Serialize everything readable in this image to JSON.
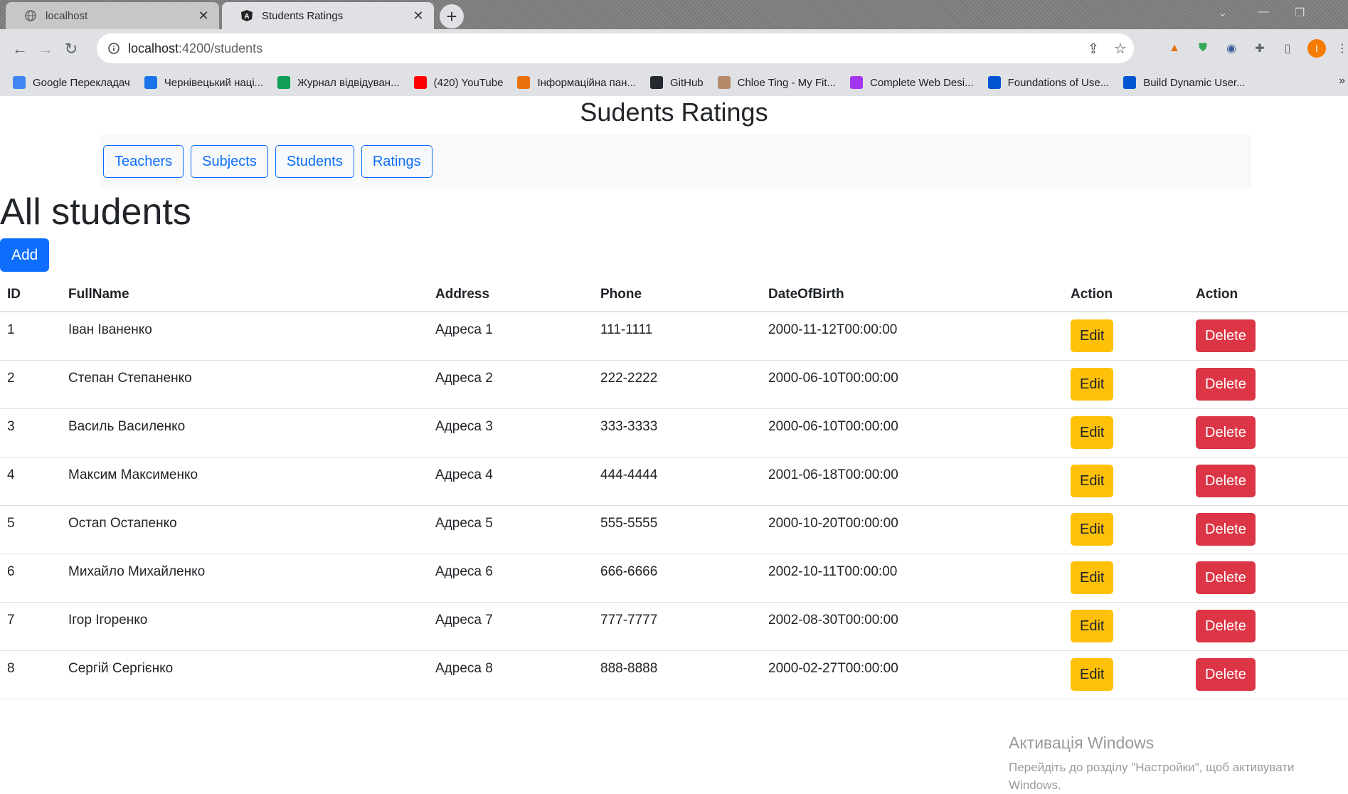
{
  "browser": {
    "tabs": [
      {
        "title": "localhost",
        "active": false
      },
      {
        "title": "Students Ratings",
        "active": true
      }
    ],
    "url_host": "localhost",
    "url_path": ":4200/students",
    "bookmarks": [
      {
        "label": "Google Перекладач",
        "icon": "google-translate-icon",
        "color": "#4285f4"
      },
      {
        "label": "Чернівецький наці...",
        "icon": "calendar-icon",
        "color": "#1a73e8"
      },
      {
        "label": "Журнал відвідуван...",
        "icon": "sheets-icon",
        "color": "#0f9d58"
      },
      {
        "label": "(420) YouTube",
        "icon": "youtube-icon",
        "color": "#ff0000"
      },
      {
        "label": "Інформаційна пан...",
        "icon": "graduation-cap-icon",
        "color": "#e8710a"
      },
      {
        "label": "GitHub",
        "icon": "github-icon",
        "color": "#24292f"
      },
      {
        "label": "Chloe Ting - My Fit...",
        "icon": "avatar-icon",
        "color": "#b58a6a"
      },
      {
        "label": "Complete Web Desi...",
        "icon": "udemy-icon",
        "color": "#a435f0"
      },
      {
        "label": "Foundations of Use...",
        "icon": "coursera-icon",
        "color": "#0056d2"
      },
      {
        "label": "Build Dynamic User...",
        "icon": "coursera-icon",
        "color": "#0056d2"
      }
    ],
    "more_bookmarks": "»"
  },
  "app": {
    "title": "Sudents Ratings",
    "nav": [
      "Teachers",
      "Subjects",
      "Students",
      "Ratings"
    ],
    "heading": "All students",
    "add_label": "Add"
  },
  "table": {
    "headers": [
      "ID",
      "FullName",
      "Address",
      "Phone",
      "DateOfBirth",
      "Action",
      "Action"
    ],
    "edit_label": "Edit",
    "delete_label": "Delete",
    "rows": [
      {
        "id": "1",
        "name": "Іван Іваненко",
        "address": "Адреса 1",
        "phone": "111-1111",
        "dob": "2000-11-12T00:00:00"
      },
      {
        "id": "2",
        "name": "Степан Степаненко",
        "address": "Адреса 2",
        "phone": "222-2222",
        "dob": "2000-06-10T00:00:00"
      },
      {
        "id": "3",
        "name": "Василь Василенко",
        "address": "Адреса 3",
        "phone": "333-3333",
        "dob": "2000-06-10T00:00:00"
      },
      {
        "id": "4",
        "name": "Максим Максименко",
        "address": "Адреса 4",
        "phone": "444-4444",
        "dob": "2001-06-18T00:00:00"
      },
      {
        "id": "5",
        "name": "Остап Остапенко",
        "address": "Адреса 5",
        "phone": "555-5555",
        "dob": "2000-10-20T00:00:00"
      },
      {
        "id": "6",
        "name": "Михайло Михайленко",
        "address": "Адреса 6",
        "phone": "666-6666",
        "dob": "2002-10-11T00:00:00"
      },
      {
        "id": "7",
        "name": "Ігор Ігоренко",
        "address": "Адреса 7",
        "phone": "777-7777",
        "dob": "2002-08-30T00:00:00"
      },
      {
        "id": "8",
        "name": "Сергій Сергієнко",
        "address": "Адреса 8",
        "phone": "888-8888",
        "dob": "2000-02-27T00:00:00"
      }
    ]
  },
  "watermark": {
    "line1": "Активація Windows",
    "line2": "Перейдіть до розділу \"Настройки\", щоб активувати Windows."
  },
  "colors": {
    "primary": "#0d6efd",
    "warning": "#ffc107",
    "danger": "#dc3545"
  }
}
